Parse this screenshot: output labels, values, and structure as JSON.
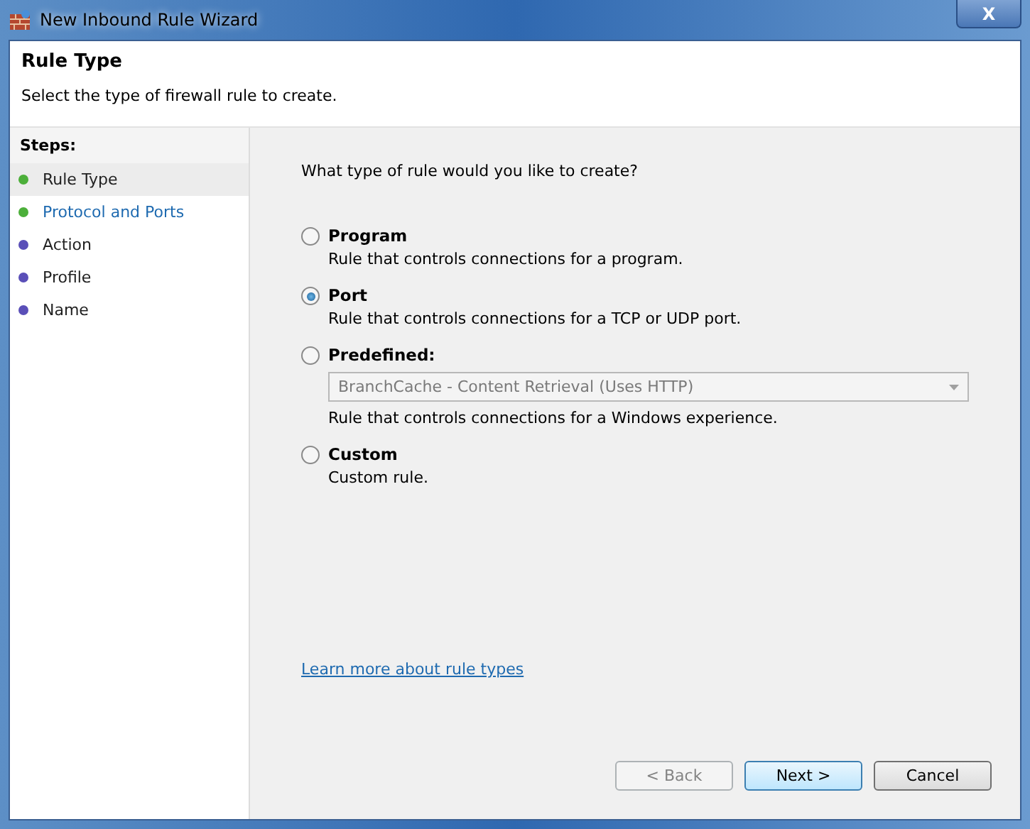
{
  "window": {
    "title": "New Inbound Rule Wizard",
    "close": "X"
  },
  "header": {
    "title": "Rule Type",
    "subtitle": "Select the type of firewall rule to create."
  },
  "steps": {
    "title": "Steps:",
    "items": [
      {
        "label": "Rule Type",
        "selected": true,
        "link": false,
        "color": "#4caf3a"
      },
      {
        "label": "Protocol and Ports",
        "selected": false,
        "link": true,
        "color": "#4caf3a"
      },
      {
        "label": "Action",
        "selected": false,
        "link": false,
        "color": "#5a4fb8"
      },
      {
        "label": "Profile",
        "selected": false,
        "link": false,
        "color": "#5a4fb8"
      },
      {
        "label": "Name",
        "selected": false,
        "link": false,
        "color": "#5a4fb8"
      }
    ]
  },
  "question": "What type of rule would you like to create?",
  "options": [
    {
      "kind": "plain",
      "label": "Program",
      "selected": false,
      "description": "Rule that controls connections for a program."
    },
    {
      "kind": "plain",
      "label": "Port",
      "selected": true,
      "description": "Rule that controls connections for a TCP or UDP port."
    },
    {
      "kind": "dropdown",
      "label": "Predefined:",
      "selected": false,
      "value": "BranchCache - Content Retrieval (Uses HTTP)",
      "disabled": true,
      "description": "Rule that controls connections for a Windows experience."
    },
    {
      "kind": "plain",
      "label": "Custom",
      "selected": false,
      "description": "Custom rule."
    }
  ],
  "learn_more": "Learn more about rule types",
  "buttons": [
    {
      "label": "< Back",
      "disabled": true,
      "default": false
    },
    {
      "label": "Next >",
      "disabled": false,
      "default": true
    },
    {
      "label": "Cancel",
      "disabled": false,
      "default": false
    }
  ]
}
